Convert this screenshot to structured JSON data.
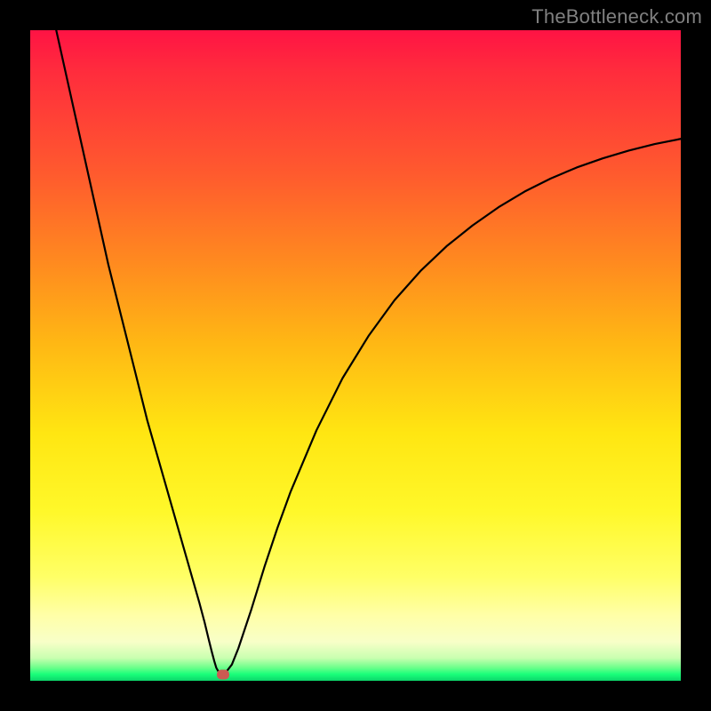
{
  "attribution": "TheBottleneck.com",
  "colors": {
    "frame": "#000000",
    "attribution_text": "#808080",
    "curve_stroke": "#000000",
    "marker_fill": "#cc5a52",
    "gradient_top": "#ff1344",
    "gradient_bottom": "#0cd66a"
  },
  "chart_data": {
    "type": "line",
    "title": "",
    "xlabel": "",
    "ylabel": "",
    "xlim": [
      0,
      100
    ],
    "ylim": [
      0,
      100
    ],
    "grid": false,
    "legend": false,
    "background_gradient": {
      "direction": "vertical",
      "stops": [
        "red",
        "orange",
        "yellow",
        "pale-yellow",
        "green"
      ]
    },
    "series": [
      {
        "name": "curve",
        "x": [
          4,
          6,
          8,
          10,
          12,
          14,
          16,
          18,
          20,
          21,
          22,
          23,
          24,
          25,
          26,
          26.8,
          27.4,
          27.9,
          28.3,
          28.6,
          29.0,
          29.5,
          30,
          31,
          32,
          34,
          36,
          38,
          40,
          44,
          48,
          52,
          56,
          60,
          64,
          68,
          72,
          76,
          80,
          84,
          88,
          92,
          96,
          100
        ],
        "y": [
          100,
          91,
          82,
          73,
          64,
          56,
          48,
          40,
          33,
          29.5,
          26,
          22.5,
          19,
          15.5,
          12,
          9,
          6.5,
          4.5,
          3,
          2,
          1.3,
          1.0,
          1.2,
          2.5,
          5,
          11,
          17.5,
          23.5,
          29,
          38.5,
          46.5,
          53,
          58.5,
          63,
          66.8,
          70,
          72.8,
          75.2,
          77.2,
          78.9,
          80.3,
          81.5,
          82.5,
          83.3
        ]
      }
    ],
    "marker": {
      "x": 29.6,
      "y": 1.0
    }
  }
}
